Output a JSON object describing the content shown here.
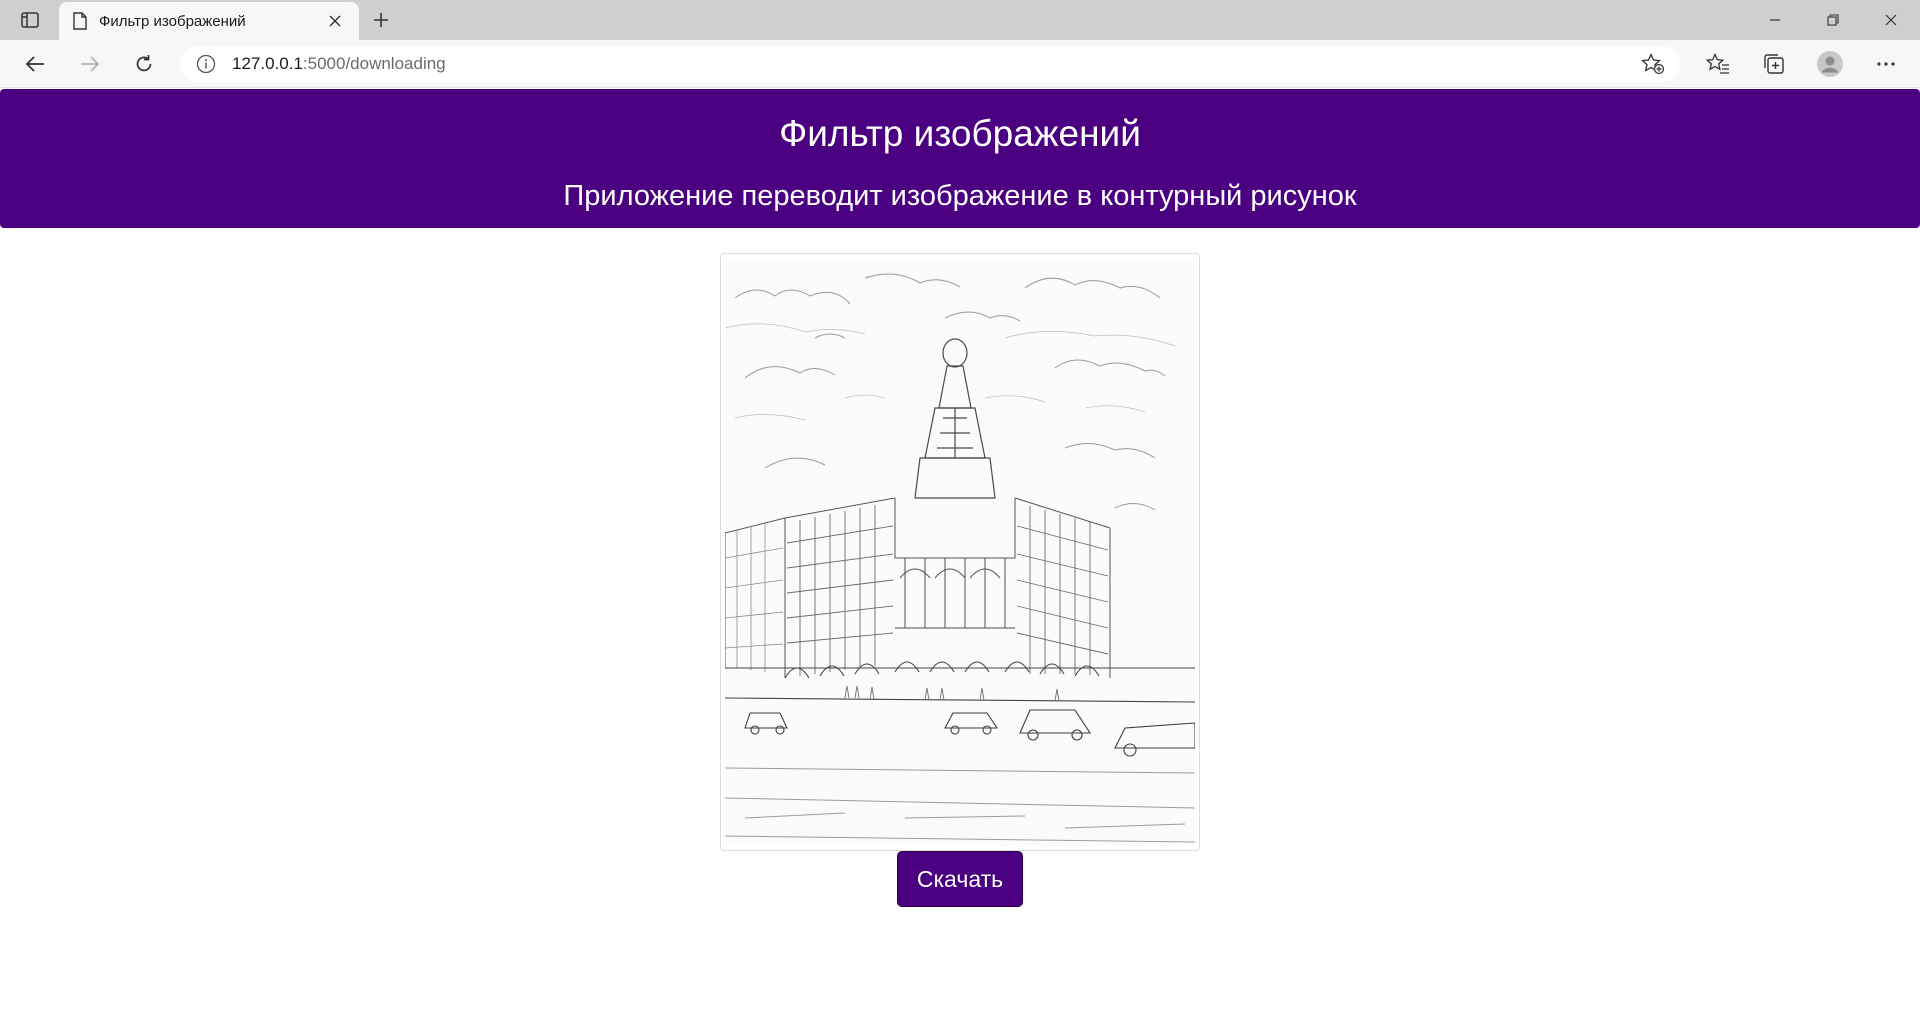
{
  "browser": {
    "tab": {
      "title": "Фильтр изображений"
    },
    "address": {
      "host": "127.0.0.1",
      "path": ":5000/downloading"
    },
    "icons": {
      "tab_actions": "tab-actions-icon",
      "page": "page-icon",
      "close": "close-icon",
      "new_tab": "plus-icon",
      "back": "arrow-left-icon",
      "forward": "arrow-right-icon",
      "refresh": "refresh-icon",
      "info": "info-icon",
      "add_favorite": "star-plus-icon",
      "favorites": "favorites-icon",
      "collections": "collections-icon",
      "profile": "profile-icon",
      "more": "more-icon",
      "minimize": "minimize-icon",
      "restore": "restore-icon",
      "close_window": "close-window-icon"
    }
  },
  "page": {
    "header": {
      "title": "Фильтр изображений",
      "subtitle": "Приложение переводит изображение в контурный рисунок"
    },
    "download_button": {
      "label": "Скачать"
    }
  },
  "colors": {
    "accent": "#4b0082",
    "header_text": "#ffffff",
    "tabbar_bg": "#cfcfcf",
    "toolbar_bg": "#f7f7f7"
  }
}
